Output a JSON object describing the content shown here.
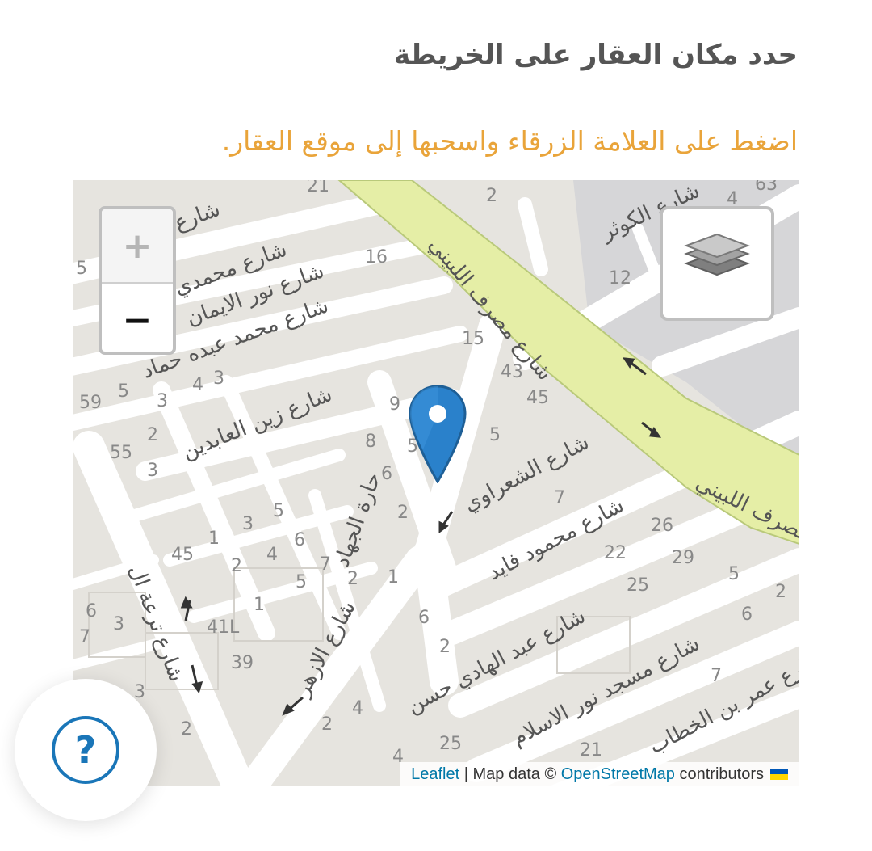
{
  "heading": "حدد مكان العقار على الخريطة",
  "instruction": "اضغط على العلامة الزرقاء واسحبها إلى موقع العقار.",
  "map": {
    "zoom_in_label": "+",
    "zoom_out_label": "−",
    "layers_icon": "layers-icon",
    "marker_icon": "location-pin-icon",
    "marker_color": "#2a81cb",
    "canal_color": "#e7f0a8",
    "street_labels": [
      "شارع مصرف اللبيني",
      "شارع الكوثر",
      "شارع محمدي",
      "شارع نور الايمان",
      "شارع محمد عبده حماد",
      "شارع زين العابدين",
      "شارع الشعراوي",
      "شارع محمود فايد",
      "شارع عبد الهادي حسن",
      "شارع مسجد نور الاسلام",
      "شارع عمر بن الخطاب",
      "شارع الازهر",
      "حارة الجهاد",
      "شارع ترعة ال",
      "مصرف اللبيني"
    ],
    "house_numbers": [
      "21",
      "2",
      "4",
      "63",
      "5",
      "16",
      "12",
      "15",
      "43",
      "45",
      "59",
      "5",
      "4",
      "3",
      "3",
      "55",
      "9",
      "8",
      "5",
      "6",
      "2",
      "7",
      "26",
      "22",
      "29",
      "25",
      "5",
      "2",
      "6",
      "45",
      "1",
      "3",
      "5",
      "4",
      "6",
      "2",
      "7",
      "5",
      "2",
      "1",
      "6",
      "7",
      "3",
      "41L",
      "39",
      "6",
      "2",
      "3",
      "2",
      "4",
      "25",
      "21",
      "7",
      "2"
    ]
  },
  "attribution": {
    "leaflet": "Leaflet",
    "separator": " | Map data © ",
    "osm": "OpenStreetMap",
    "suffix": " contributors"
  },
  "help": {
    "label": "?",
    "color": "#1a76b8"
  }
}
